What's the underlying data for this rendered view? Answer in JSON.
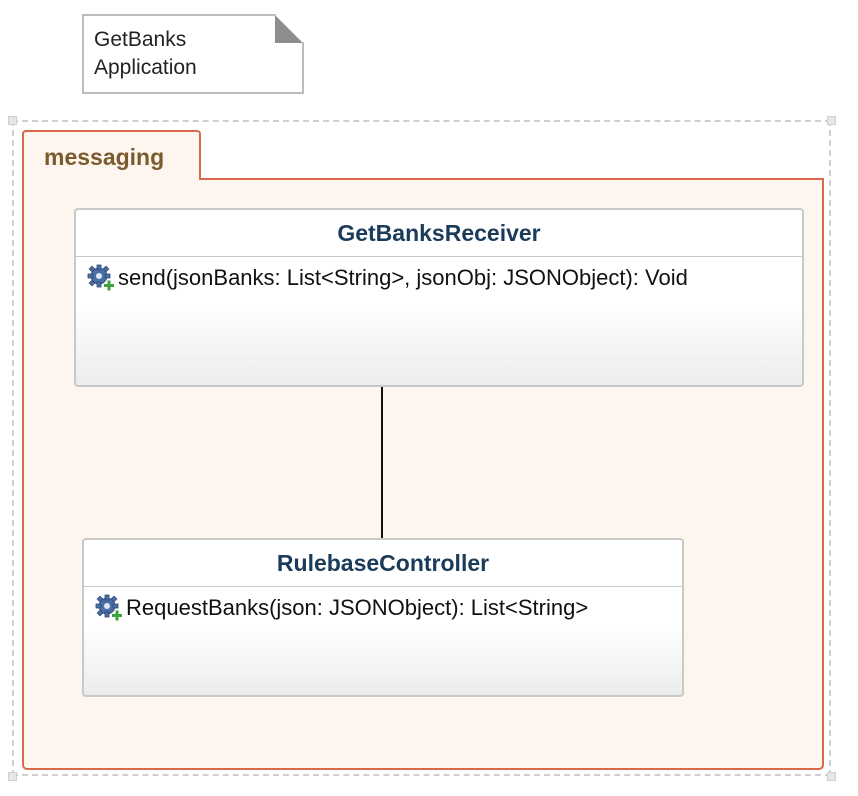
{
  "note": {
    "line1": "GetBanks",
    "line2": "Application"
  },
  "package": {
    "name": "messaging"
  },
  "classes": [
    {
      "name": "GetBanksReceiver",
      "operations": [
        {
          "icon": "gear-add-icon",
          "signature": "send(jsonBanks: List<String>, jsonObj: JSONObject): Void"
        }
      ]
    },
    {
      "name": "RulebaseController",
      "operations": [
        {
          "icon": "gear-add-icon",
          "signature": "RequestBanks(json: JSONObject): List<String>"
        }
      ]
    }
  ],
  "colors": {
    "package_border": "#d9694a",
    "package_fill": "#fdf6ee",
    "package_label": "#7a5b2e",
    "class_name": "#1b3b5a",
    "class_border": "#c9c9c9"
  }
}
